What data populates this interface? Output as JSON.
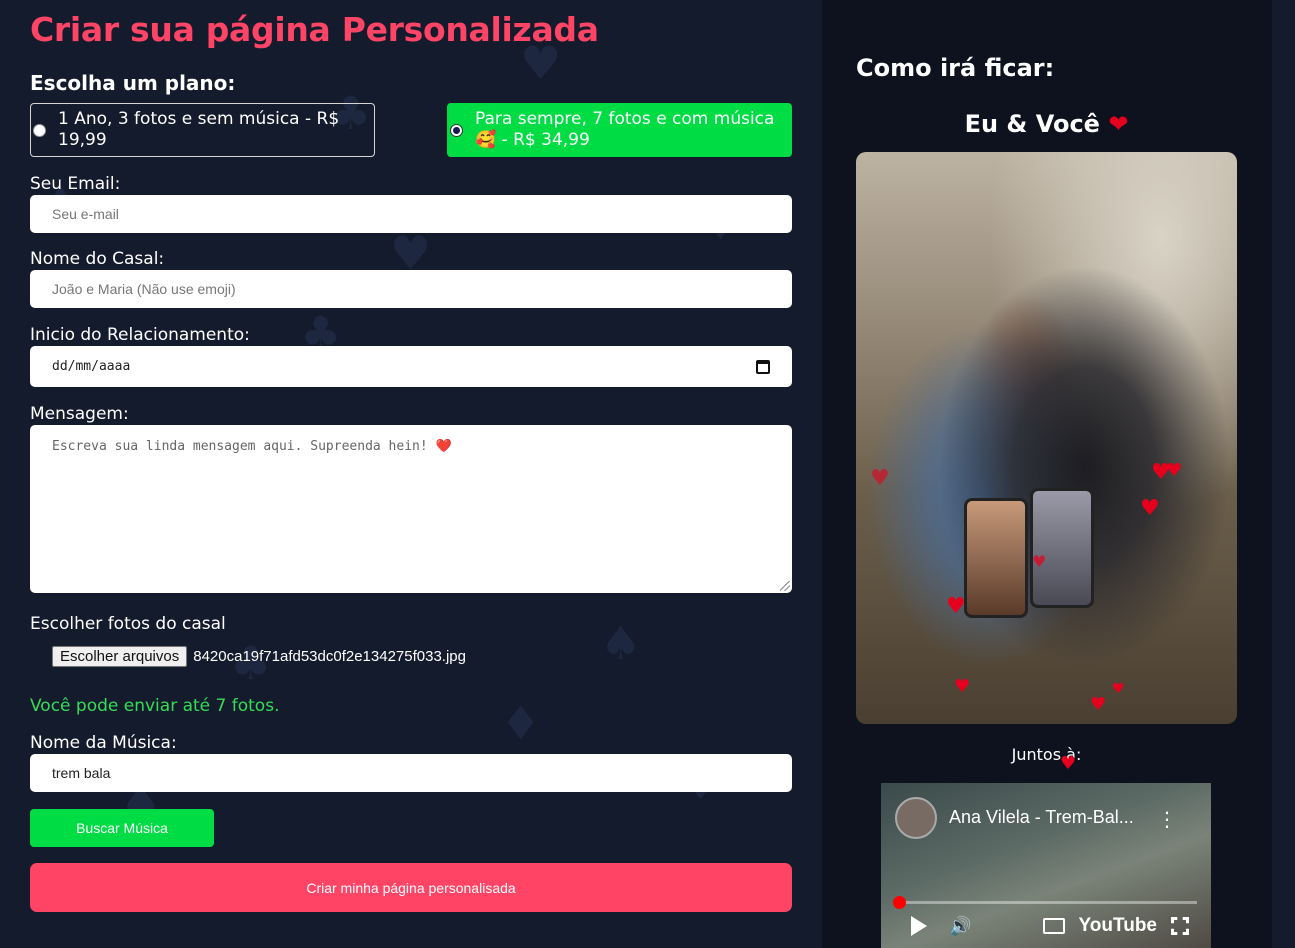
{
  "form": {
    "title": "Criar sua página Personalizada",
    "plan_heading": "Escolha um plano:",
    "plans": [
      {
        "label": "1 Ano, 3 fotos e sem música - R$ 19,99",
        "selected": false
      },
      {
        "label": "Para sempre, 7 fotos e com música 🥰 - R$ 34,99",
        "selected": true
      }
    ],
    "email": {
      "label": "Seu Email:",
      "placeholder": "Seu e-mail",
      "value": ""
    },
    "couple_name": {
      "label": "Nome do Casal:",
      "placeholder": "João e Maria (Não use emoji)",
      "value": ""
    },
    "start_date": {
      "label": "Inicio do Relacionamento:",
      "placeholder": "dd/mm/aaaa"
    },
    "message": {
      "label": "Mensagem:",
      "placeholder": "Escreva sua linda mensagem aqui. Supreenda hein! ❤️"
    },
    "photos": {
      "label": "Escolher fotos do casal",
      "button": "Escolher arquivos",
      "file_name": "8420ca19f71afd53dc0f2e134275f033.jpg",
      "hint": "Você pode enviar até 7 fotos."
    },
    "music": {
      "label": "Nome da Música:",
      "value": "trem bala"
    },
    "search_button": "Buscar Música",
    "create_button": "Criar minha página personalisada"
  },
  "preview": {
    "heading": "Como irá ficar:",
    "couple_title": "Eu & Você",
    "couple_heart": "❤",
    "together_label": "Juntos à:",
    "video": {
      "title": "Ana Vilela - Trem-Bal...",
      "brand": "YouTube",
      "progress": 0
    }
  },
  "colors": {
    "accent_pink": "#ff4466",
    "accent_green": "#00dd44",
    "background": "#141b2d",
    "preview_background": "#0d121e",
    "heart": "#e6001e"
  }
}
